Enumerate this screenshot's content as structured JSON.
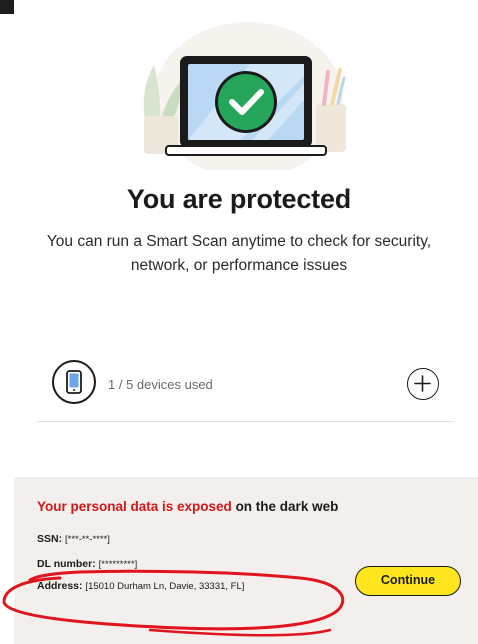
{
  "hero": {
    "illustration": "laptop-with-check",
    "accent_green": "#26a65b"
  },
  "headline": "You are protected",
  "subtext": "You can run a Smart Scan anytime to check for security, network, or performance issues",
  "devices": {
    "icon": "smartphone-icon",
    "count_label": "1 / 5 devices used",
    "add_icon": "plus-icon"
  },
  "dark_web": {
    "title_alert": "Your personal data is exposed",
    "title_rest": " on the dark web",
    "fields": [
      {
        "label": "SSN: ",
        "value": "[***-**-****]"
      },
      {
        "label": "DL number: ",
        "value": "[*********]"
      },
      {
        "label": "Address: ",
        "value": "[15010 Durham Ln, Davie, 33331, FL]"
      }
    ],
    "continue_label": "Continue"
  },
  "colors": {
    "alert_red": "#d01818",
    "button_yellow": "#ffe51e",
    "panel_bg": "#f2efec",
    "annotation_red": "#e0141c"
  }
}
